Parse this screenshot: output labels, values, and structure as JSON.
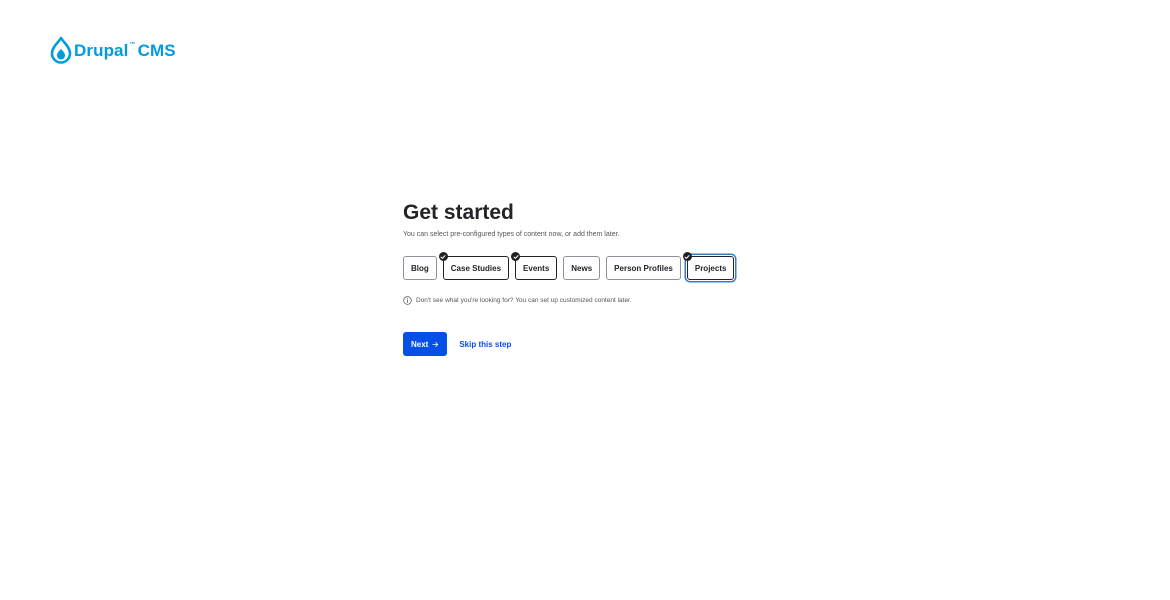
{
  "brand": {
    "name": "Drupal",
    "trademark": "™",
    "product": "CMS",
    "color": "#009cde"
  },
  "main": {
    "title": "Get started",
    "subtitle": "You can select pre-configured types of content now, or add them later.",
    "options": [
      {
        "label": "Blog",
        "selected": false
      },
      {
        "label": "Case Studies",
        "selected": true
      },
      {
        "label": "Events",
        "selected": true
      },
      {
        "label": "News",
        "selected": false
      },
      {
        "label": "Person Profiles",
        "selected": false
      },
      {
        "label": "Projects",
        "selected": true,
        "focused": true
      }
    ],
    "hint": "Don't see what you're looking for? You can set up customized content later.",
    "next_label": "Next",
    "skip_label": "Skip this step",
    "accent_color": "#0550e6"
  }
}
